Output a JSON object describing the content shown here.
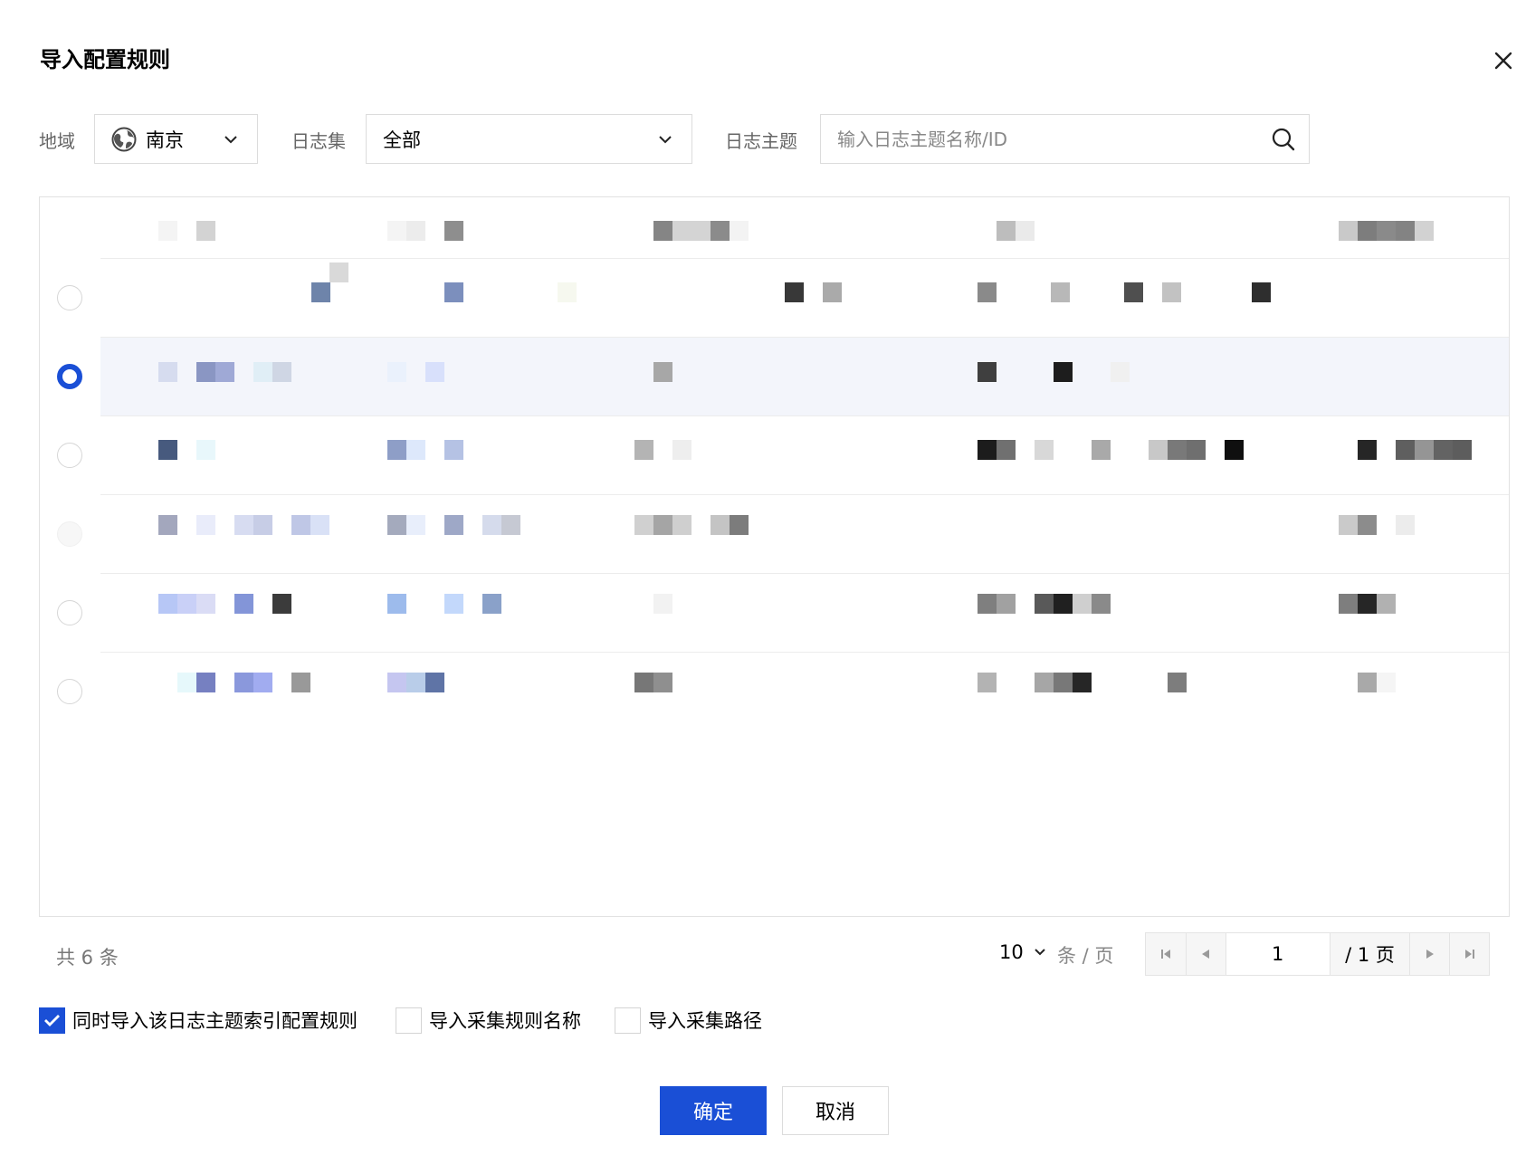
{
  "dialog": {
    "title": "导入配置规则"
  },
  "filters": {
    "region_label": "地域",
    "region_value": "南京",
    "logset_label": "日志集",
    "logset_value": "全部",
    "topic_label": "日志主题",
    "topic_placeholder": "输入日志主题名称/ID"
  },
  "table": {
    "rows": [
      {
        "selected": false
      },
      {
        "selected": true
      },
      {
        "selected": false
      },
      {
        "selected": false
      },
      {
        "selected": false
      },
      {
        "selected": false
      }
    ]
  },
  "pagination": {
    "total_text": "共 6 条",
    "page_size": "10",
    "page_size_unit": "条 / 页",
    "current_page": "1",
    "total_pages_text": "/ 1 页"
  },
  "options": {
    "import_index_label": "同时导入该日志主题索引配置规则",
    "import_index_checked": true,
    "import_rule_name_label": "导入采集规则名称",
    "import_rule_name_checked": false,
    "import_path_label": "导入采集路径",
    "import_path_checked": false
  },
  "actions": {
    "confirm_label": "确定",
    "cancel_label": "取消"
  },
  "colors": {
    "primary": "#1a4fd6",
    "selected_row_bg": "#f3f5fb"
  }
}
